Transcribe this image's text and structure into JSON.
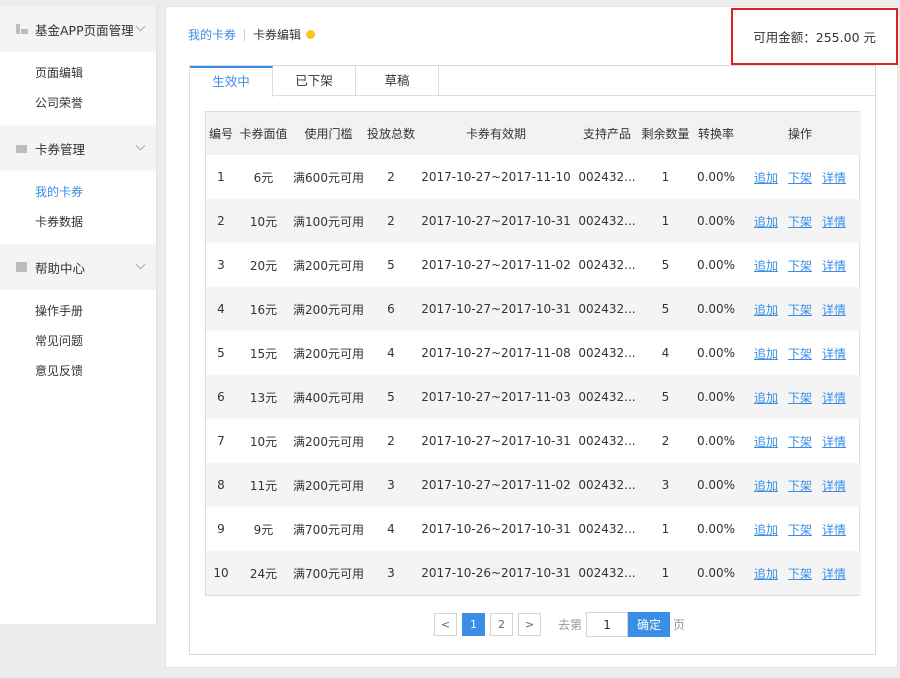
{
  "sidebar": {
    "groups": [
      {
        "title": "基金APP页面管理",
        "icon": "pages-icon",
        "items": [
          "页面编辑",
          "公司荣誉"
        ]
      },
      {
        "title": "卡券管理",
        "icon": "card-icon",
        "items": [
          "我的卡券",
          "卡券数据"
        ]
      },
      {
        "title": "帮助中心",
        "icon": "help-icon",
        "items": [
          "操作手册",
          "常见问题",
          "意见反馈"
        ]
      }
    ],
    "active_item": "我的卡券"
  },
  "breadcrumb": {
    "link": "我的卡券",
    "current": "卡券编辑"
  },
  "balance": {
    "text": "可用金额：255.00 元"
  },
  "tabs": [
    "生效中",
    "已下架",
    "草稿"
  ],
  "active_tab": "生效中",
  "table": {
    "headers": [
      "编号",
      "卡券面值",
      "使用门槛",
      "投放总数",
      "卡券有效期",
      "支持产品",
      "剩余数量",
      "转换率",
      "操作"
    ],
    "rows": [
      [
        "1",
        "6元",
        "满600元可用",
        "2",
        "2017-10-27~2017-11-10",
        "002432...",
        "1",
        "0.00%"
      ],
      [
        "2",
        "10元",
        "满100元可用",
        "2",
        "2017-10-27~2017-10-31",
        "002432...",
        "1",
        "0.00%"
      ],
      [
        "3",
        "20元",
        "满200元可用",
        "5",
        "2017-10-27~2017-11-02",
        "002432...",
        "5",
        "0.00%"
      ],
      [
        "4",
        "16元",
        "满200元可用",
        "6",
        "2017-10-27~2017-10-31",
        "002432...",
        "5",
        "0.00%"
      ],
      [
        "5",
        "15元",
        "满200元可用",
        "4",
        "2017-10-27~2017-11-08",
        "002432...",
        "4",
        "0.00%"
      ],
      [
        "6",
        "13元",
        "满400元可用",
        "5",
        "2017-10-27~2017-11-03",
        "002432...",
        "5",
        "0.00%"
      ],
      [
        "7",
        "10元",
        "满200元可用",
        "2",
        "2017-10-27~2017-10-31",
        "002432...",
        "2",
        "0.00%"
      ],
      [
        "8",
        "11元",
        "满200元可用",
        "3",
        "2017-10-27~2017-11-02",
        "002432...",
        "3",
        "0.00%"
      ],
      [
        "9",
        "9元",
        "满700元可用",
        "4",
        "2017-10-26~2017-10-31",
        "002432...",
        "1",
        "0.00%"
      ],
      [
        "10",
        "24元",
        "满700元可用",
        "3",
        "2017-10-26~2017-10-31",
        "002432...",
        "1",
        "0.00%"
      ]
    ],
    "actions": [
      "追加",
      "下架",
      "详情"
    ]
  },
  "pagination": {
    "prev": "<",
    "next": ">",
    "pages": [
      "1",
      "2"
    ],
    "current": "1",
    "goto_label": "去第",
    "goto_value": "1",
    "confirm_label": "确定",
    "unit_label": "页"
  },
  "colors": {
    "accent": "#3a8ee6",
    "highlight_border": "#e02020",
    "hint_dot": "#f5c518"
  }
}
